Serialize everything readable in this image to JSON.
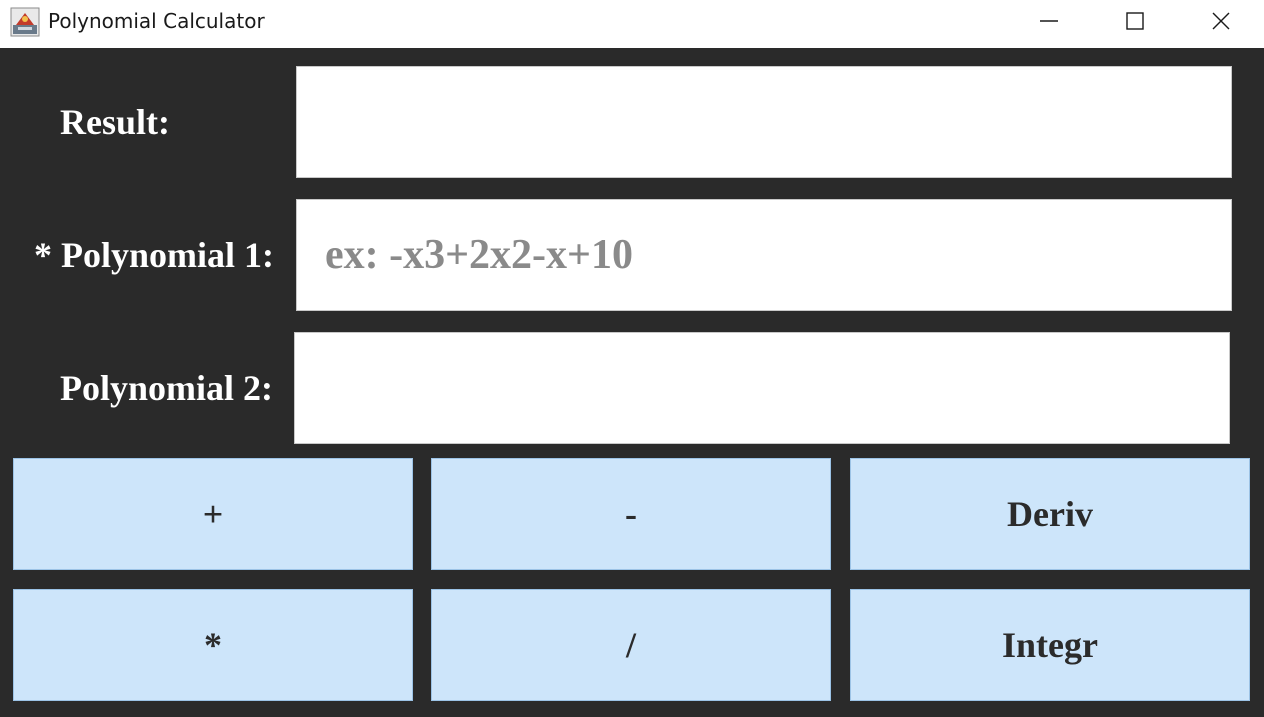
{
  "window": {
    "title": "Polynomial Calculator",
    "app_icon": "java-app-icon",
    "controls": [
      "minimize-icon",
      "maximize-icon",
      "close-icon"
    ]
  },
  "form": {
    "result_label": "Result:",
    "result_value": "",
    "poly1_label": "* Polynomial 1:",
    "poly1_value": "",
    "poly1_placeholder": "ex: -x3+2x2-x+10",
    "poly2_label": "Polynomial 2:",
    "poly2_value": ""
  },
  "operations": {
    "add": "+",
    "subtract": "-",
    "derivative": "Deriv",
    "multiply": "*",
    "divide": "/",
    "integrate": "Integr"
  },
  "colors": {
    "background": "#2a2a2a",
    "button_fill": "#cde5fa",
    "label_text": "#ffffff",
    "placeholder_text": "#8a8a8a"
  }
}
